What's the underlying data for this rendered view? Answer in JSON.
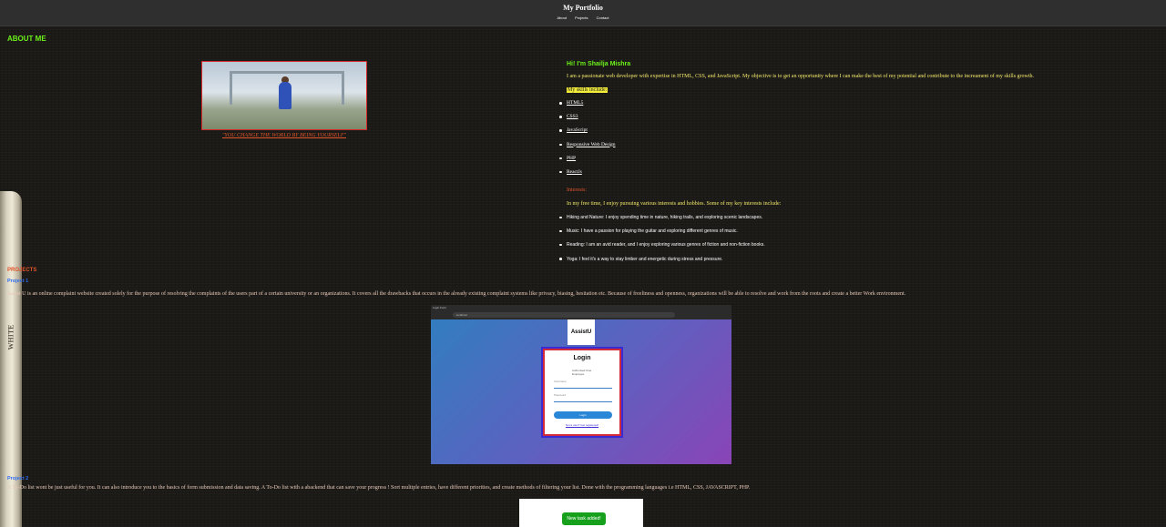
{
  "header": {
    "title": "My Portfolio",
    "nav": [
      "About",
      "Projects",
      "Contact"
    ]
  },
  "about": {
    "heading": "ABOUT ME",
    "quote": "\"YOU CHANGE THE WORLD BY BEING YOURSELF\"",
    "greeting": "Hi! I'm Shailja Mishra",
    "intro": "I am a passionate web developer with expertise in HTML, CSS, and JavaScript. My objective is to get an opportunity where I can make the best of my potential and contribute to the increament of my skills growth.",
    "skills_label": "My skills include:",
    "skills": [
      "HTML5",
      "CSS3",
      "JavaScript",
      "Responsive Web Design",
      "PHP",
      "ReactJs"
    ],
    "interests_label": "Interests:",
    "interests_text": "In my free time, I enjoy pursuing various interests and hobbies. Some of my key interests include:",
    "interests": [
      "Hiking and Nature: I enjoy spending time in nature, hiking trails, and exploring scenic landscapes.",
      "Music: I have a passion for playing the guitar and exploring different genres of music.",
      "Reading: I am an avid reader, and I enjoy exploring various genres of fiction and non-fiction books.",
      "Yoga: I feel it's a way to stay limber and energetic during stress and pressure."
    ]
  },
  "pencil_label": "WHITE",
  "projects": {
    "heading": "PROJECTS",
    "items": [
      {
        "title": "Project 1",
        "desc": "Assist U is an online complaint website created solely for the purpose of resolving the complaints of the users part of a certain university or an organizations. It covers all the drawbacks that occurs in the already existing complaint systems like privacy, biasing, hesitation etc. Because of freeliness and openness, organizations will be able to resolve and work from the roots and create a better Work environment.",
        "screenshot": {
          "tab": "Login Form",
          "url": "localhost",
          "logo": "AssistU",
          "login_title": "Login",
          "options": [
            "Authorised User",
            "Employee"
          ],
          "fields": [
            "Username",
            "Password"
          ],
          "button": "Login",
          "link": "Not a user? Get registered!"
        }
      },
      {
        "title": "Project 2",
        "desc": "A To-Do list wont be just useful for you. It can also introduce you to the basics of form submission and data saving. A To-Do list with a abackend that can save your progress ! Sort multiple entries, have different priorities, and create methods of filtering your list. Done with the programming languages i.e HTML, CSS, JAVASCRIPT, PHP.",
        "screenshot": {
          "toast": "New task added!"
        }
      }
    ]
  }
}
